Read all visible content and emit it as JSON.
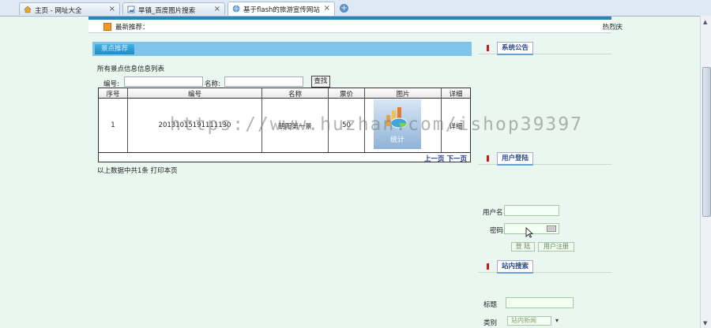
{
  "browser": {
    "tabs": [
      {
        "label": "主页 - 网址大全",
        "active": false,
        "close": "×"
      },
      {
        "label": "旱镇_百度图片搜索",
        "active": false,
        "close": "×"
      },
      {
        "label": "基于flash的旅游宣传网站",
        "active": true,
        "close": "×"
      }
    ],
    "new_tab": "+"
  },
  "news": {
    "label": "最新推荐：",
    "right": "热烈庆"
  },
  "left": {
    "tab_label": "景点推荐",
    "list_title": "所有景点信息信息列表",
    "search": {
      "code_label": "编号:",
      "name_label": "名称:",
      "button": "查找",
      "code_value": "",
      "name_value": ""
    },
    "columns": [
      "序号",
      "编号",
      "名称",
      "票价",
      "图片",
      "详细"
    ],
    "rows": [
      {
        "index": "1",
        "code": "20131015191111130",
        "name": "朝阳第一景",
        "price": "50",
        "image_label": "统计",
        "detail": "详细"
      }
    ],
    "pager": {
      "prev": "上一页",
      "next": "下一页"
    },
    "summary": "以上数据中共1条  打印本页"
  },
  "right": {
    "notice_title": "系统公告",
    "login_title": "用户登陆",
    "username_label": "用户名",
    "password_label": "密码",
    "login_button": "登 陆",
    "register_button": "用户注册",
    "search_title": "站内搜索",
    "title_label": "标题",
    "category_label": "类别",
    "category_value": "站内新闻"
  },
  "watermark": "https://www.huzhan.com/ishop39397",
  "colors": {
    "accent": "#2a86b9",
    "header_bar": "#7fc4ea",
    "red_marker": "#c81a1a",
    "page_bg": "#eaf6f0"
  }
}
